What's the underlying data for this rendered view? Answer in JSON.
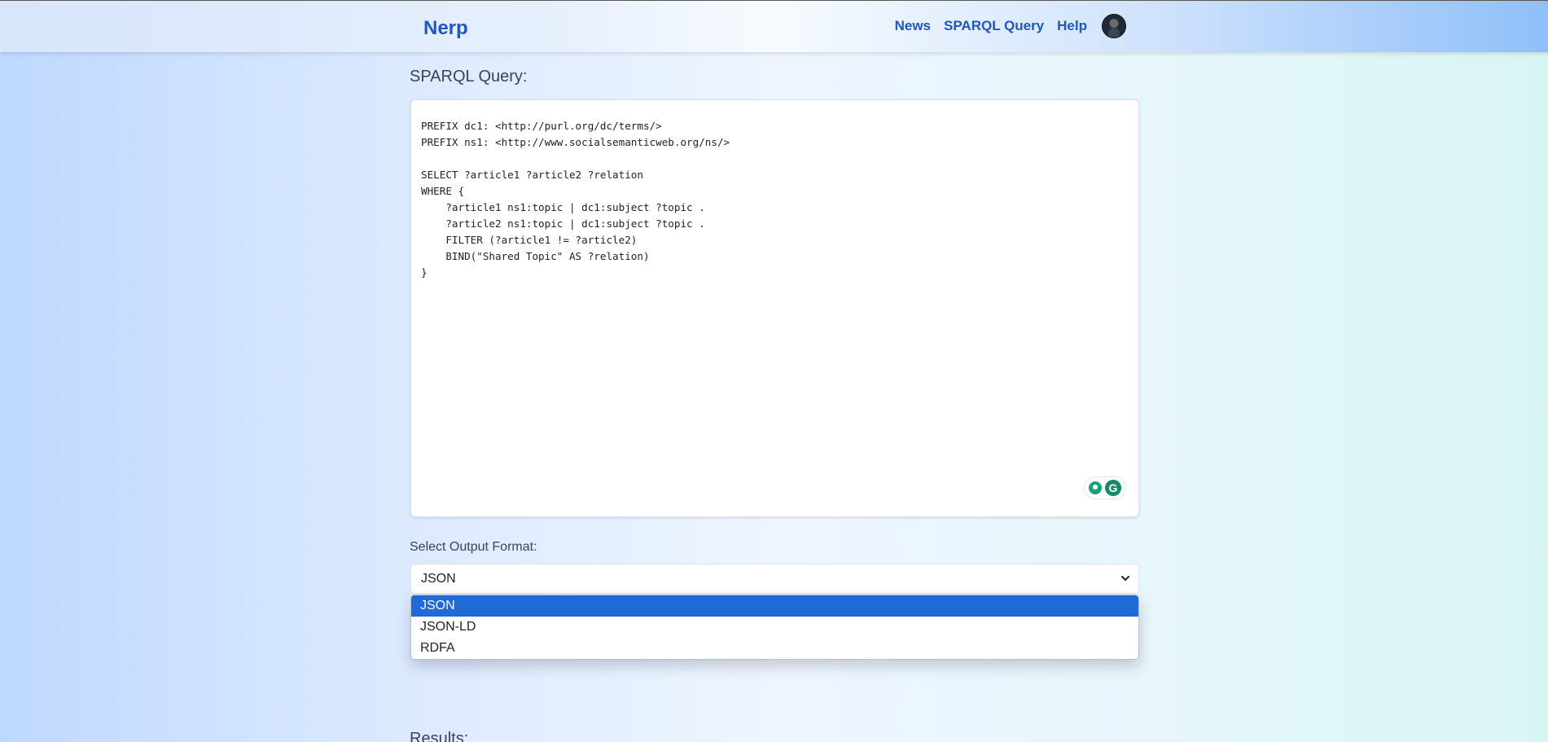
{
  "navbar": {
    "brand": "Nerp",
    "links": [
      "News",
      "SPARQL Query",
      "Help"
    ]
  },
  "query_section": {
    "title": "SPARQL Query:",
    "query_text": "PREFIX dc1: <http://purl.org/dc/terms/>\nPREFIX ns1: <http://www.socialsemanticweb.org/ns/>\n\nSELECT ?article1 ?article2 ?relation\nWHERE {\n    ?article1 ns1:topic | dc1:subject ?topic .\n    ?article2 ns1:topic | dc1:subject ?topic .\n    FILTER (?article1 != ?article2)\n    BIND(\"Shared Topic\" AS ?relation)\n}"
  },
  "output_format": {
    "label": "Select Output Format:",
    "selected": "JSON",
    "options": [
      "JSON",
      "JSON-LD",
      "RDFA"
    ]
  },
  "results": {
    "title": "Results:"
  },
  "colors": {
    "brand": "#1f55c7",
    "option_highlight": "#1e6ad6"
  }
}
